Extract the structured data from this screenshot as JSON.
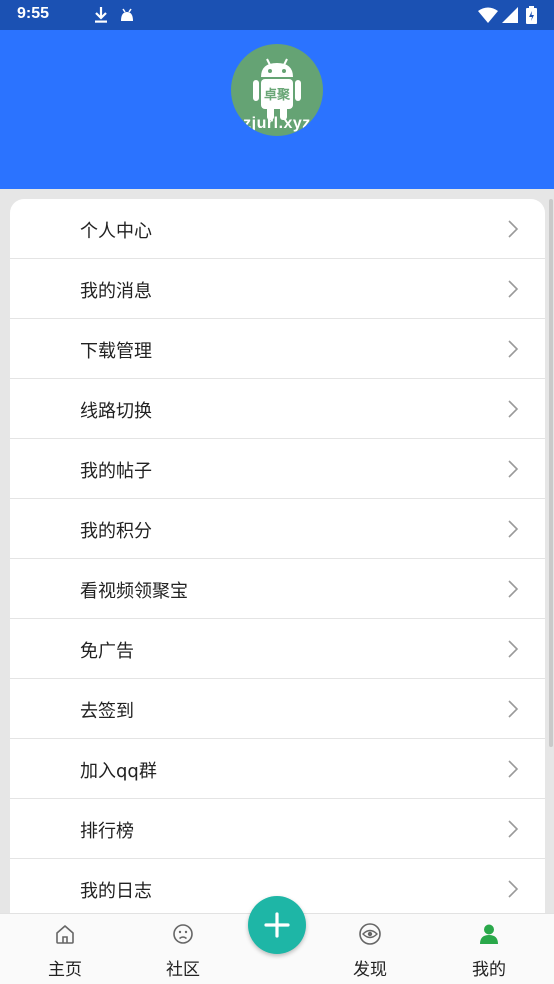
{
  "status_bar": {
    "time": "9:55",
    "icons": [
      "download-icon",
      "android-notification-icon",
      "wifi-icon",
      "signal-icon",
      "battery-icon"
    ]
  },
  "header": {
    "avatar_brand": "卓聚",
    "avatar_url": "zjurl.xyz",
    "background_color": "#2b73ff"
  },
  "menu": {
    "items": [
      {
        "label": "个人中心"
      },
      {
        "label": "我的消息"
      },
      {
        "label": "下载管理"
      },
      {
        "label": "线路切换"
      },
      {
        "label": "我的帖子"
      },
      {
        "label": "我的积分"
      },
      {
        "label": "看视频领聚宝"
      },
      {
        "label": "免广告"
      },
      {
        "label": "去签到"
      },
      {
        "label": "加入qq群"
      },
      {
        "label": "排行榜"
      },
      {
        "label": "我的日志"
      }
    ]
  },
  "bottom_nav": {
    "items": [
      {
        "label": "主页",
        "icon": "home-icon"
      },
      {
        "label": "社区",
        "icon": "face-icon"
      },
      {
        "label": "发现",
        "icon": "eye-icon"
      },
      {
        "label": "我的",
        "icon": "person-icon",
        "active": true
      }
    ],
    "fab_icon": "plus-icon",
    "active_color": "#2aa84a",
    "fab_color": "#1eb6a6"
  }
}
